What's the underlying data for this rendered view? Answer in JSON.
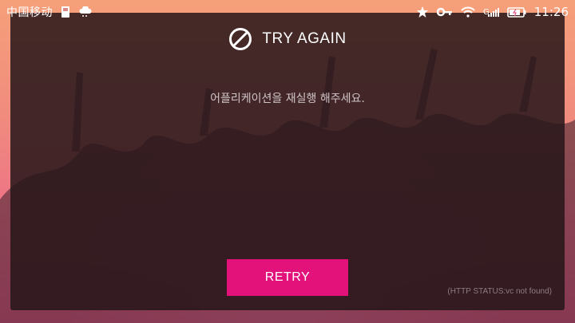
{
  "status_bar": {
    "carrier": "中国移动",
    "time": "11:26",
    "signal_label": "G",
    "icons": [
      "sim-storage-icon",
      "weather-cloud-icon",
      "star-icon",
      "key-icon",
      "wifi-icon",
      "signal-icon",
      "battery-icon"
    ]
  },
  "dialog": {
    "icon": "prohibited-icon",
    "title": "TRY AGAIN",
    "message": "어플리케이션을 재실행 해주세요.",
    "retry_label": "RETRY",
    "http_status": "(HTTP STATUS:vc not found)"
  },
  "colors": {
    "accent": "#e2127a",
    "dialog_bg": "#26161a",
    "background_top": "#f6a07a",
    "background_bottom": "#e35a84"
  }
}
